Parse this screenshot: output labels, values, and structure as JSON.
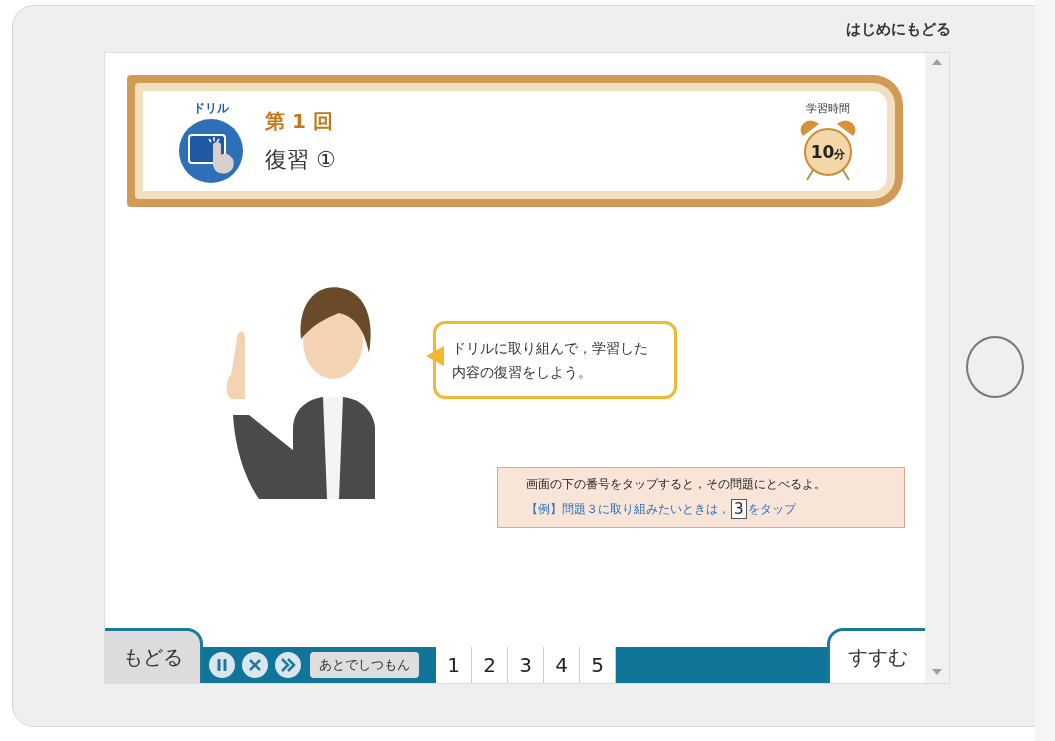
{
  "header_link": "はじめにもどる",
  "lesson": {
    "badge": "ドリル",
    "number": "第 1 回",
    "title": "復習 ①",
    "time_label": "学習時間",
    "time": "10",
    "time_unit": "分"
  },
  "speech": "ドリルに取り組んで，学習した内容の復習をしよう。",
  "hint": {
    "text": "画面の下の番号をタップすると，その問題にとべるよ。",
    "example_prefix": "【例】問題３に取り組みたいときは，",
    "example_key": "3",
    "example_suffix": "をタップ"
  },
  "footer": {
    "back": "もどる",
    "later": "あとでしつもん",
    "numbers": [
      "1",
      "2",
      "3",
      "4",
      "5"
    ],
    "next": "すすむ"
  }
}
